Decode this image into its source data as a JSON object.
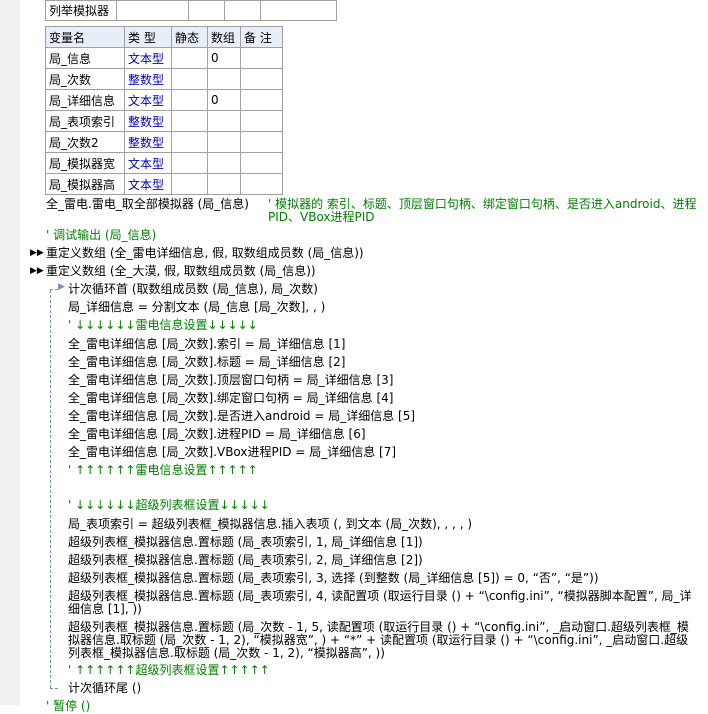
{
  "subroutine": {
    "name": "列举模拟器"
  },
  "var_table": {
    "headers": [
      "变量名",
      "类 型",
      "静态",
      "数组",
      "备 注"
    ],
    "rows": [
      {
        "name": "局_信息",
        "type": "文本型",
        "static": "",
        "array": "0",
        "note": ""
      },
      {
        "name": "局_次数",
        "type": "整数型",
        "static": "",
        "array": "",
        "note": ""
      },
      {
        "name": "局_详细信息",
        "type": "文本型",
        "static": "",
        "array": "0",
        "note": ""
      },
      {
        "name": "局_表项索引",
        "type": "整数型",
        "static": "",
        "array": "",
        "note": ""
      },
      {
        "name": "局_次数2",
        "type": "整数型",
        "static": "",
        "array": "",
        "note": ""
      },
      {
        "name": "局_模拟器宽",
        "type": "文本型",
        "static": "",
        "array": "",
        "note": ""
      },
      {
        "name": "局_模拟器高",
        "type": "文本型",
        "static": "",
        "array": "",
        "note": ""
      }
    ]
  },
  "code": {
    "l1": "全_雷电.雷电_取全部模拟器 (局_信息)",
    "l1_comment": "' 模拟器的 索引、标题、顶层窗口句柄、绑定窗口句柄、是否进入android、进程PID、VBox进程PID",
    "l2": "' 调试输出 (局_信息)",
    "l3": "重定义数组 (全_雷电详细信息, 假, 取数组成员数 (局_信息))",
    "l4": "重定义数组 (全_大漠, 假, 取数组成员数 (局_信息))",
    "l5": "计次循环首 (取数组成员数 (局_信息), 局_次数)",
    "l6": "局_详细信息 = 分割文本 (局_信息 [局_次数], , )",
    "l7": "' ↓↓↓↓↓↓雷电信息设置↓↓↓↓↓",
    "l8": "全_雷电详细信息 [局_次数].索引 = 局_详细信息 [1]",
    "l9": "全_雷电详细信息 [局_次数].标题 = 局_详细信息 [2]",
    "l10": "全_雷电详细信息 [局_次数].顶层窗口句柄 = 局_详细信息 [3]",
    "l11": "全_雷电详细信息 [局_次数].绑定窗口句柄 = 局_详细信息 [4]",
    "l12": "全_雷电详细信息 [局_次数].是否进入android = 局_详细信息 [5]",
    "l13": "全_雷电详细信息 [局_次数].进程PID = 局_详细信息 [6]",
    "l14": "全_雷电详细信息 [局_次数].VBox进程PID = 局_详细信息 [7]",
    "l15": "' ↑↑↑↑↑↑雷电信息设置↑↑↑↑↑",
    "l16": "' ↓↓↓↓↓↓超级列表框设置↓↓↓↓↓",
    "l17": "局_表项索引 = 超级列表框_模拟器信息.插入表项 (, 到文本 (局_次数), , , , )",
    "l18": "超级列表框_模拟器信息.置标题 (局_表项索引, 1, 局_详细信息 [1])",
    "l19": "超级列表框_模拟器信息.置标题 (局_表项索引, 2, 局_详细信息 [2])",
    "l20": "超级列表框_模拟器信息.置标题 (局_表项索引, 3, 选择 (到整数 (局_详细信息 [5]) = 0, “否”, “是”))",
    "l21": "超级列表框_模拟器信息.置标题 (局_表项索引, 4, 读配置项 (取运行目录 () + “\\config.ini”, “模拟器脚本配置”, 局_详细信息 [1], ))",
    "l22": "超级列表框_模拟器信息.置标题 (局_次数 - 1, 5, 读配置项 (取运行目录 () + “\\config.ini”, _启动窗口.超级列表框_模拟器信息.取标题 (局_次数 - 1, 2), “模拟器宽”, ) + “*” + 读配置项 (取运行目录 () + “\\config.ini”, _启动窗口.超级列表框_模拟器信息.取标题 (局_次数 - 1, 2), “模拟器高”, ))",
    "l23": "' ↑↑↑↑↑↑超级列表框设置↑↑↑↑↑",
    "l24": "计次循环尾 ()",
    "l25": "' 暂停 ()"
  }
}
